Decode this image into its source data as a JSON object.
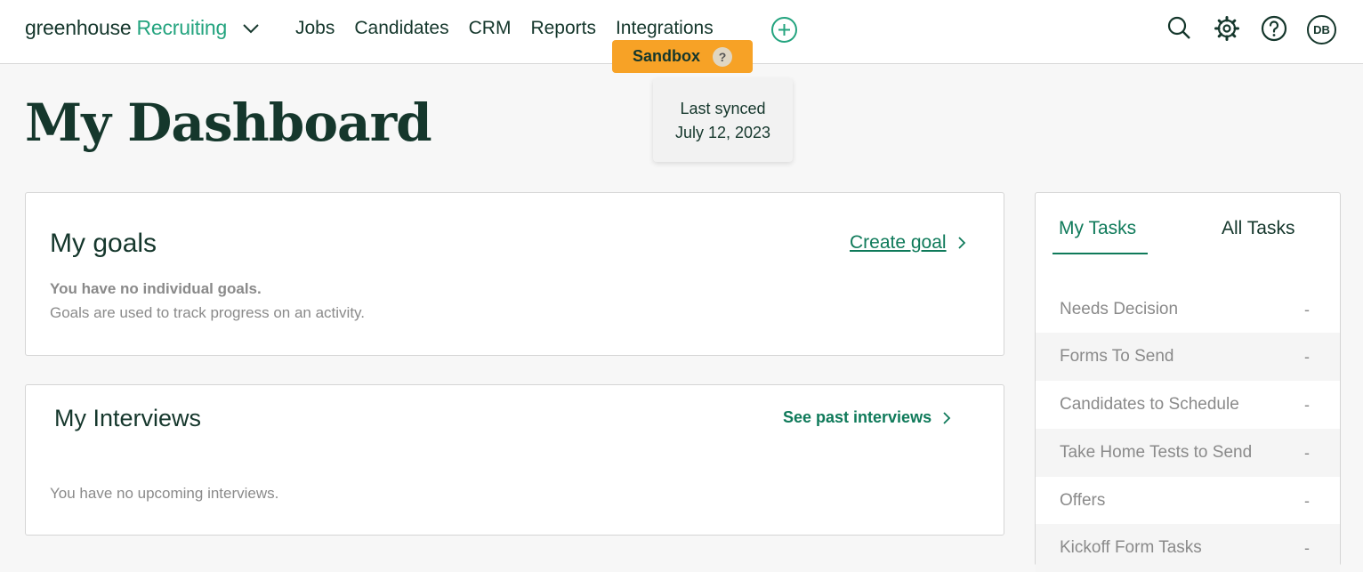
{
  "brand": {
    "word1": "greenhouse",
    "word2": "Recruiting"
  },
  "nav": [
    "Jobs",
    "Candidates",
    "CRM",
    "Reports",
    "Integrations"
  ],
  "sandbox": {
    "label": "Sandbox",
    "help": "?"
  },
  "tooltip": {
    "line1": "Last synced",
    "line2": "July 12, 2023"
  },
  "icons": [
    "chevron-down-icon",
    "plus-circle-icon",
    "search-icon",
    "gear-icon",
    "help-icon",
    "chevron-right-icon"
  ],
  "avatar": {
    "initials": "DB"
  },
  "page": {
    "title": "My Dashboard"
  },
  "goals": {
    "title": "My goals",
    "link": "Create goal",
    "empty_bold": "You have no individual goals.",
    "empty_text": "Goals are used to track progress on an activity."
  },
  "interviews": {
    "title": "My Interviews",
    "link": "See past interviews",
    "empty_text": "You have no upcoming interviews."
  },
  "tasks": {
    "tabs": [
      "My Tasks",
      "All Tasks"
    ],
    "items": [
      {
        "label": "Needs Decision",
        "count": "-"
      },
      {
        "label": "Forms To Send",
        "count": "-"
      },
      {
        "label": "Candidates to Schedule",
        "count": "-"
      },
      {
        "label": "Take Home Tests to Send",
        "count": "-"
      },
      {
        "label": "Offers",
        "count": "-"
      },
      {
        "label": "Kickoff Form Tasks",
        "count": "-"
      }
    ]
  },
  "colors": {
    "brand_green": "#24a47f",
    "link_green": "#0f7a5a",
    "dark_text": "#15372c",
    "sandbox_orange": "#f7a226"
  }
}
